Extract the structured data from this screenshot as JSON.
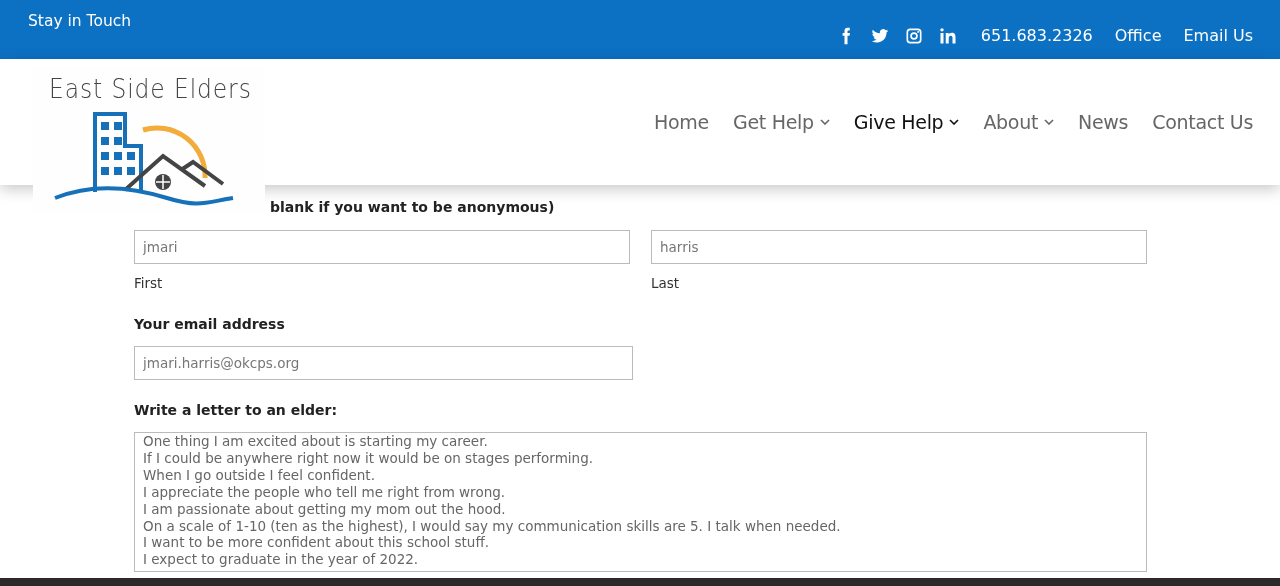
{
  "top_bar": {
    "title": "Stay in Touch",
    "social": [
      {
        "kind": "facebook"
      },
      {
        "kind": "twitter"
      },
      {
        "kind": "instagram"
      },
      {
        "kind": "linkedin"
      }
    ],
    "links": [
      "651.683.2326",
      "Office",
      "Email Us"
    ]
  },
  "header": {
    "logo_text": "East Side Elders",
    "nav": [
      {
        "label": "Home",
        "has_menu": false,
        "selected": false
      },
      {
        "label": "Get Help",
        "has_menu": true,
        "selected": false
      },
      {
        "label": "Give Help",
        "has_menu": true,
        "selected": true
      },
      {
        "label": "About",
        "has_menu": true,
        "selected": false
      },
      {
        "label": "News",
        "has_menu": false,
        "selected": false
      },
      {
        "label": "Contact Us",
        "has_menu": false,
        "selected": false
      }
    ]
  },
  "form": {
    "name_label": "blank if you want to be anonymous)",
    "first": {
      "value": "jmari",
      "caption": "First"
    },
    "last": {
      "value": "harris",
      "caption": "Last"
    },
    "email_label": "Your email address",
    "email": {
      "value": "jmari.harris@okcps.org"
    },
    "letter_label": "Write a letter to an elder:",
    "letter_lines": [
      "One thing I am excited about is starting my career.",
      "If I could be anywhere right now it would be on stages performing.",
      "When I go outside I feel confident.",
      "I appreciate the people who tell me right from wrong.",
      "I am passionate about getting my mom out the hood.",
      "On a scale of 1-10 (ten as the highest), I would say my communication skills are 5. I talk when needed.",
      "I want to be more confident about this school stuff.",
      "I expect to graduate in the year of 2022."
    ]
  }
}
